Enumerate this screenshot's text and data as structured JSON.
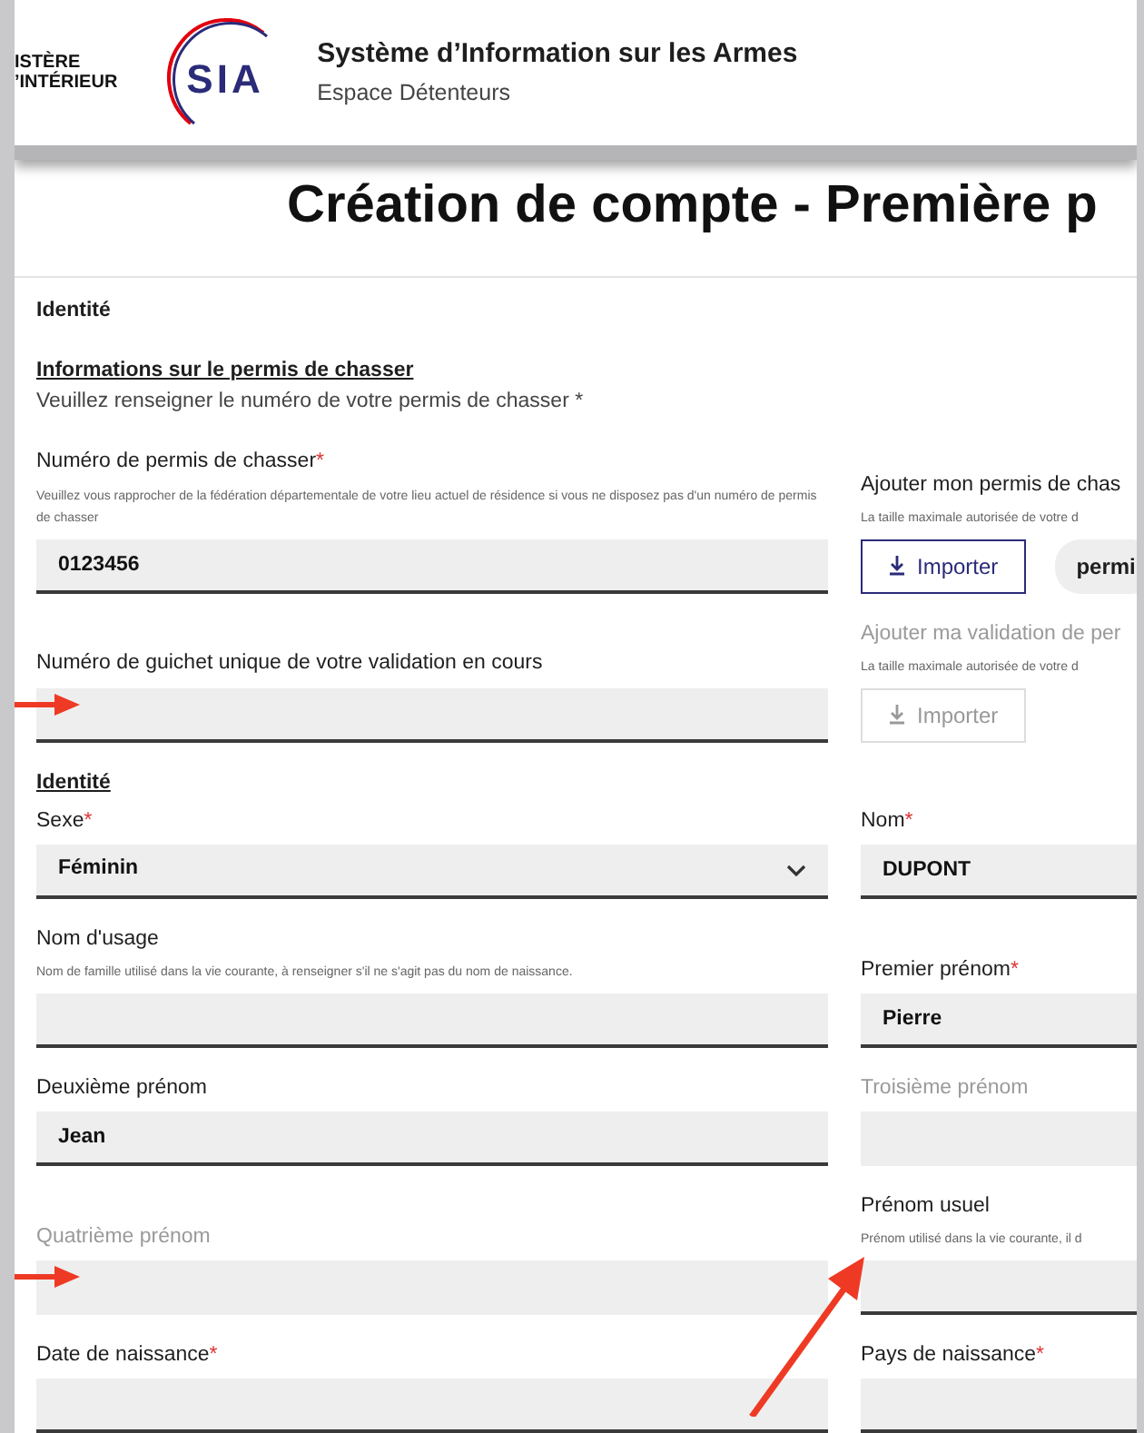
{
  "header": {
    "ministry_lines": [
      "ISTÈRE",
      "’INTÉRIEUR"
    ],
    "logo_text": "SIA",
    "app_title": "Système d’Information sur les Armes",
    "app_subtitle": "Espace Détenteurs"
  },
  "page_title": "Création de compte - Première p",
  "step_label": "Identité",
  "permit_section": {
    "heading": "Informations sur le permis de chasser",
    "instruction": "Veuillez renseigner le numéro de votre permis de chasser *"
  },
  "rows": [
    {
      "left": {
        "kind": "input",
        "label": "Numéro de permis de chasser",
        "required_mark": "*",
        "disabled": false,
        "hint": "Veuillez vous rapprocher de la fédération départementale de votre lieu actuel de résidence si vous ne disposez pas d'un numéro de permis de chasser",
        "value": "0123456",
        "marked": false
      },
      "right": {
        "kind": "upload",
        "label": "Ajouter mon permis de chas",
        "disabled": false,
        "hint": "La taille maximale autorisée de votre d",
        "button": "Importer",
        "file": "permi",
        "marked": false
      }
    },
    {
      "left": {
        "kind": "input",
        "label": "Numéro de guichet unique de votre validation en cours",
        "disabled": false,
        "marked": true
      },
      "right": {
        "kind": "upload",
        "label": "Ajouter ma validation de per",
        "disabled": true,
        "hint": "La taille maximale autorisée de votre d",
        "button": "Importer",
        "marked": false
      }
    },
    {
      "heading": "Identité",
      "left": {
        "kind": "select",
        "label": "Sexe",
        "required_mark": "*",
        "disabled": false,
        "value": "Féminin",
        "marked": false
      },
      "right": {
        "kind": "input",
        "label": "Nom",
        "required_mark": "*",
        "disabled": false,
        "value": "DUPONT",
        "marked": false
      }
    },
    {
      "left": {
        "kind": "input",
        "label": "Nom d'usage",
        "disabled": false,
        "hint": "Nom de famille utilisé dans la vie courante, à renseigner s'il ne s'agit pas du nom de naissance.",
        "marked": false
      },
      "right": {
        "kind": "input",
        "label": "Premier prénom",
        "required_mark": "*",
        "disabled": false,
        "value": "Pierre",
        "marked": false
      }
    },
    {
      "left": {
        "kind": "input",
        "label": "Deuxième prénom",
        "disabled": false,
        "value": "Jean",
        "marked": false
      },
      "right": {
        "kind": "input",
        "label": "Troisième prénom",
        "disabled": true,
        "marked": false
      }
    },
    {
      "left": {
        "kind": "input",
        "label": "Quatrième prénom",
        "disabled": true,
        "marked": true
      },
      "right": {
        "kind": "input",
        "label": "Prénom usuel",
        "disabled": false,
        "hint": "Prénom utilisé dans la vie courante, il d",
        "marked": true
      }
    },
    {
      "left": {
        "kind": "input",
        "label": "Date de naissance",
        "required_mark": "*",
        "disabled": false,
        "marked": false
      },
      "right": {
        "kind": "input",
        "label": "Pays de naissance",
        "required_mark": "*",
        "disabled": false,
        "marked": false
      }
    }
  ]
}
